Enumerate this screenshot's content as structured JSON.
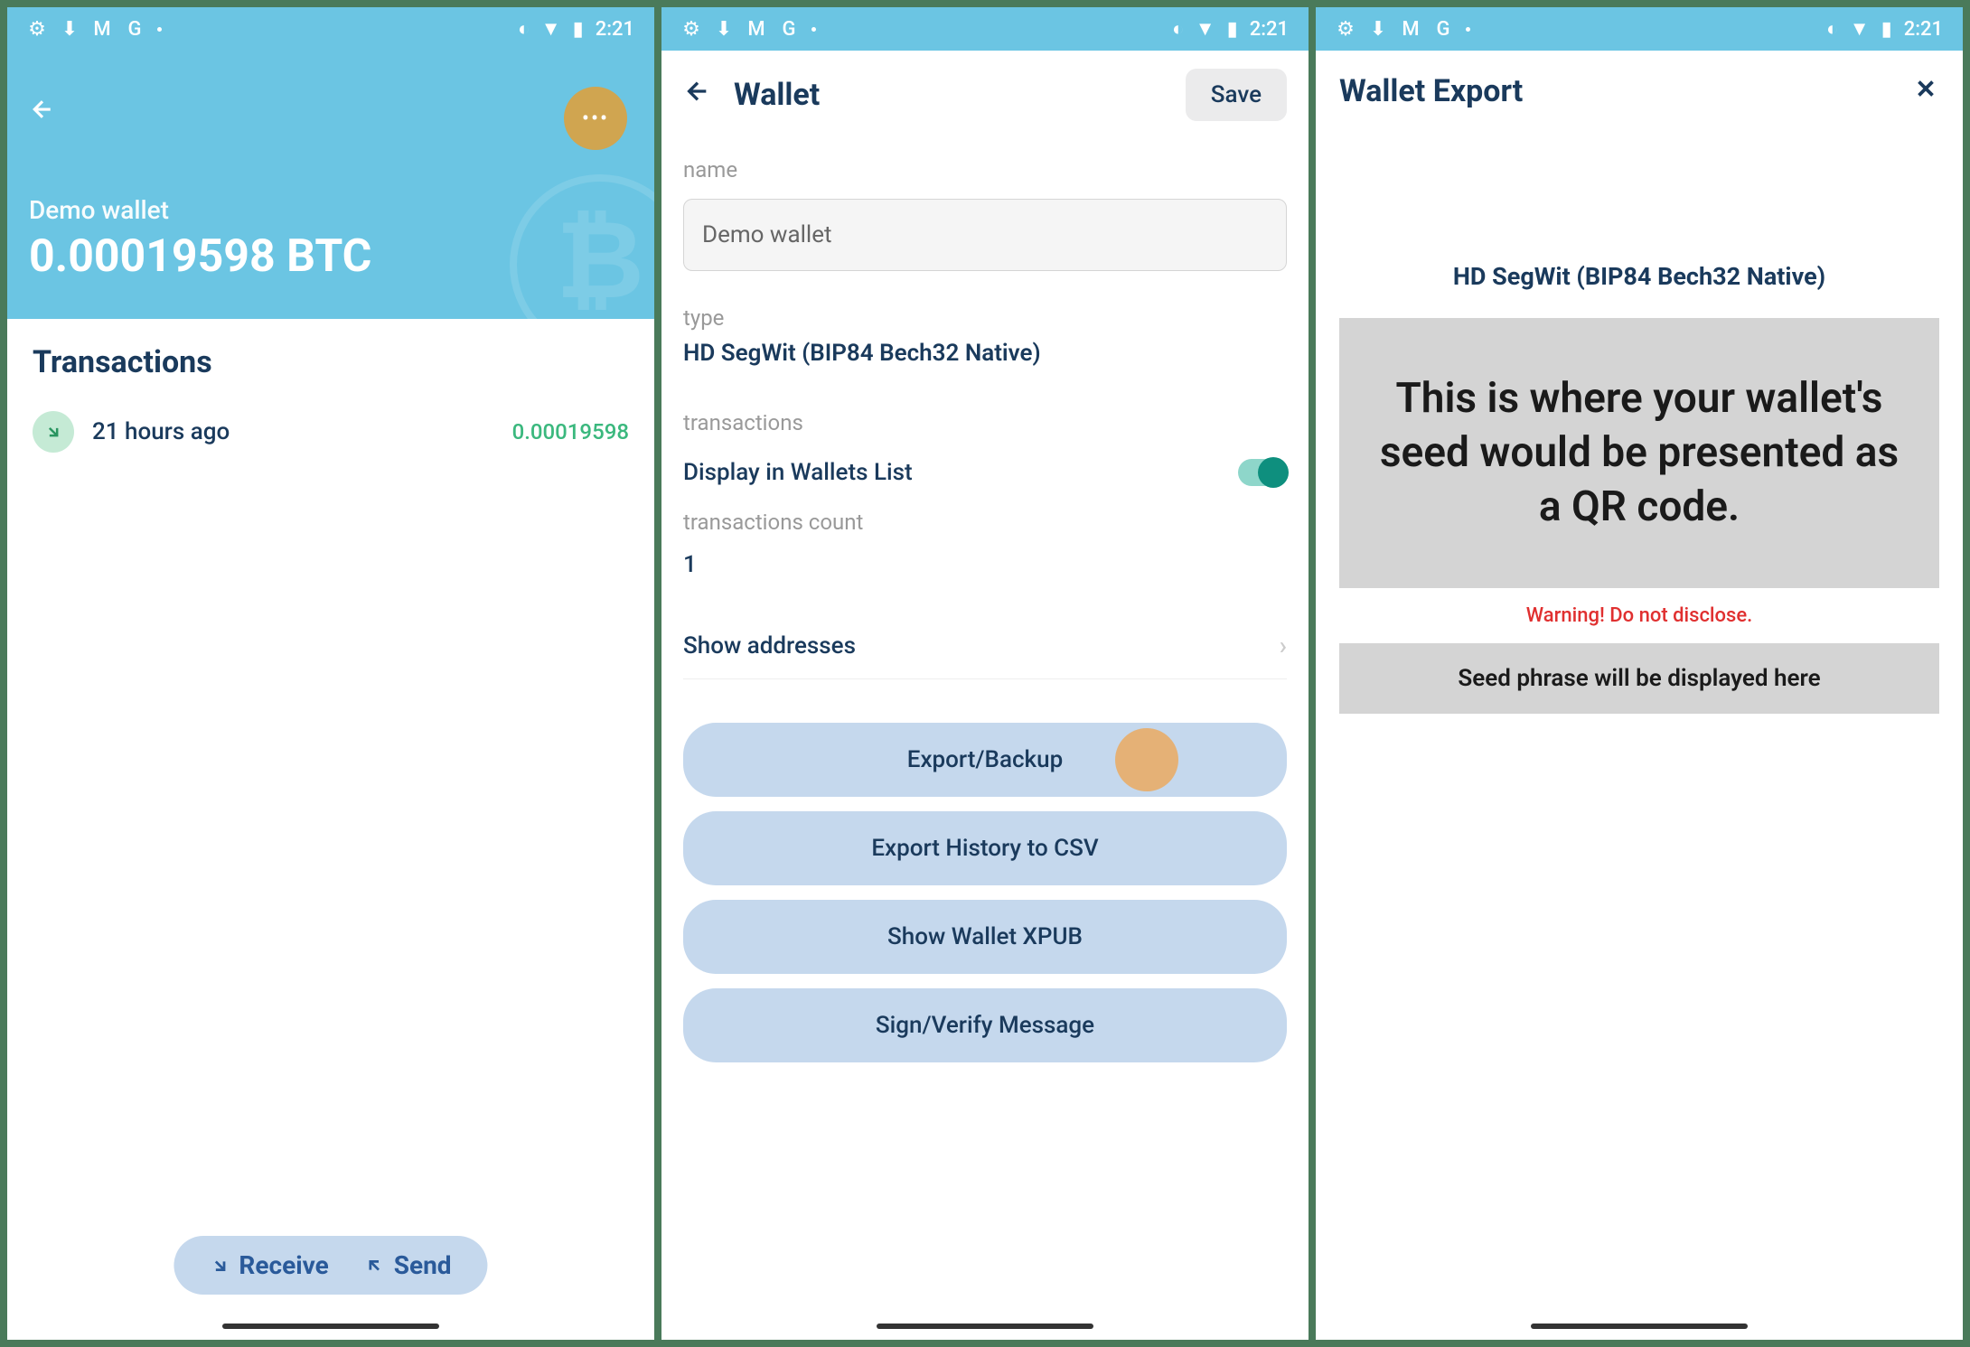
{
  "status": {
    "time": "2:21"
  },
  "screen1": {
    "wallet_name": "Demo wallet",
    "balance": "0.00019598 BTC",
    "tx_title": "Transactions",
    "tx_time": "21 hours ago",
    "tx_amount": "0.00019598",
    "receive": "Receive",
    "send": "Send"
  },
  "screen2": {
    "title": "Wallet",
    "save": "Save",
    "name_label": "name",
    "name_value": "Demo wallet",
    "type_label": "type",
    "type_value": "HD SegWit (BIP84 Bech32 Native)",
    "tx_label": "transactions",
    "display_label": "Display in Wallets List",
    "tx_count_label": "transactions count",
    "tx_count": "1",
    "show_addresses": "Show addresses",
    "actions": {
      "export_backup": "Export/Backup",
      "export_csv": "Export History to CSV",
      "show_xpub": "Show Wallet XPUB",
      "sign_verify": "Sign/Verify Message"
    }
  },
  "screen3": {
    "title": "Wallet Export",
    "type": "HD SegWit (BIP84 Bech32 Native)",
    "qr_placeholder": "This is where your wallet's seed would be presented as a QR code.",
    "warning": "Warning! Do not disclose.",
    "seed_placeholder": "Seed phrase will be displayed here"
  }
}
